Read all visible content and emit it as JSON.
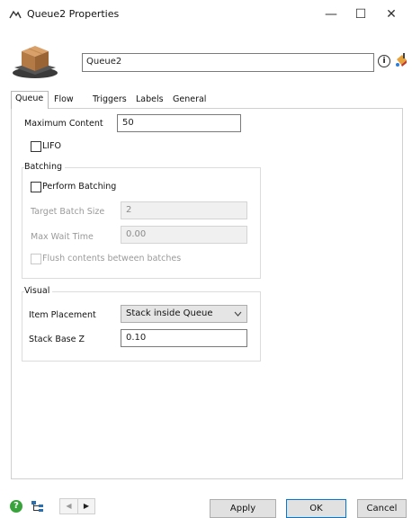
{
  "window": {
    "title": "Queue2 Properties",
    "minimize_glyph": "—",
    "maximize_glyph": "☐",
    "close_glyph": "✕"
  },
  "header": {
    "object_name": "Queue2",
    "info_glyph": "i"
  },
  "tabs": [
    {
      "label": "Queue"
    },
    {
      "label": "Flow"
    },
    {
      "label": "Triggers"
    },
    {
      "label": "Labels"
    },
    {
      "label": "General"
    }
  ],
  "queue": {
    "max_content_label": "Maximum Content",
    "max_content_value": "50",
    "lifo_label": "LIFO",
    "batching": {
      "group_label": "Batching",
      "perform_batching_label": "Perform Batching",
      "target_batch_size_label": "Target Batch Size",
      "target_batch_size_value": "2",
      "max_wait_time_label": "Max Wait Time",
      "max_wait_time_value": "0.00",
      "flush_label": "Flush contents between batches"
    },
    "visual": {
      "group_label": "Visual",
      "item_placement_label": "Item Placement",
      "item_placement_value": "Stack inside Queue",
      "stack_base_z_label": "Stack Base Z",
      "stack_base_z_value": "0.10"
    }
  },
  "footer": {
    "help_glyph": "?",
    "prev_glyph": "◀",
    "next_glyph": "▶",
    "apply_label": "Apply",
    "ok_label": "OK",
    "cancel_label": "Cancel"
  }
}
